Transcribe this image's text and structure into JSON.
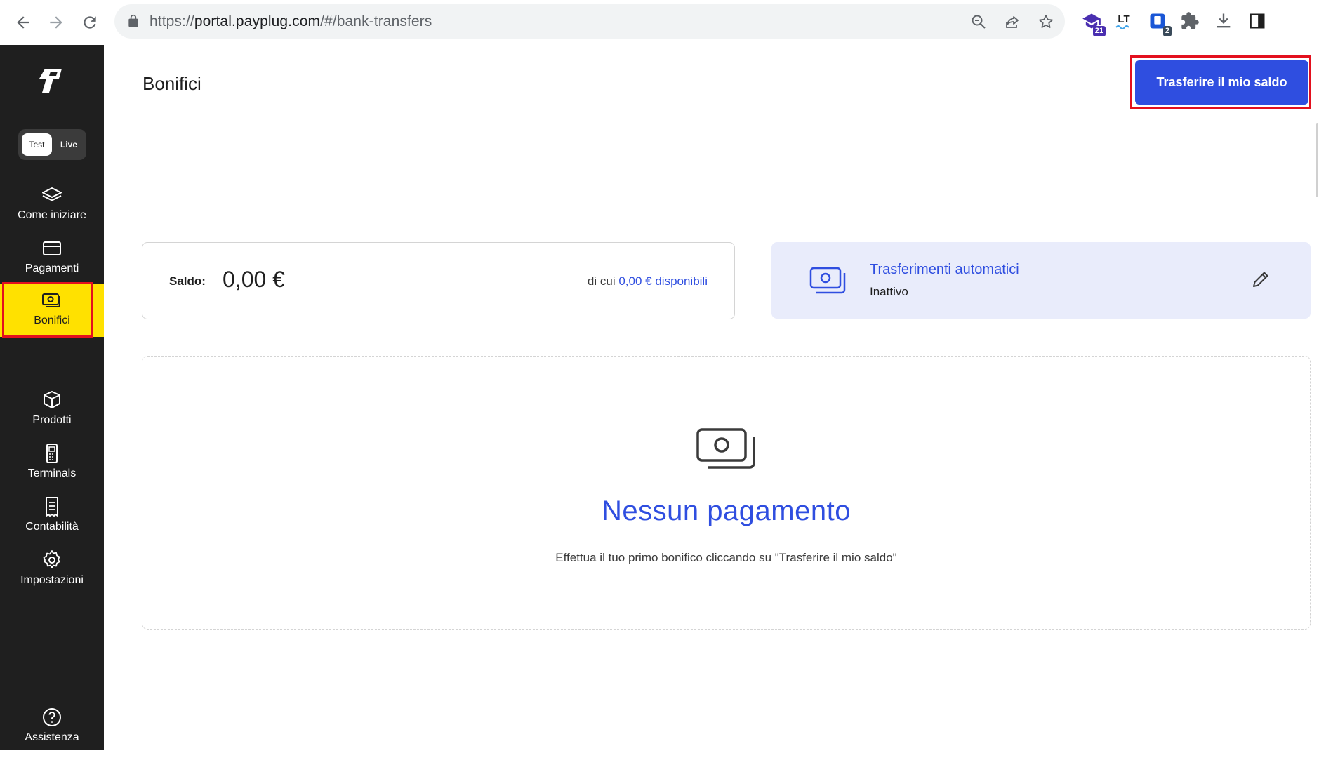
{
  "browser": {
    "url_prefix": "https://",
    "url_host": "portal.payplug.com",
    "url_path": "/#/bank-transfers",
    "extensions": {
      "graduation_badge": "21",
      "lt_label": "LT",
      "shield_badge": "2"
    }
  },
  "sidebar": {
    "mode_toggle": {
      "test": "Test",
      "live": "Live",
      "selected": "Test"
    },
    "items": [
      {
        "label": "Come iniziare",
        "icon": "layers-icon"
      },
      {
        "label": "Pagamenti",
        "icon": "card-icon"
      },
      {
        "label": "Bonifici",
        "icon": "money-icon",
        "active": true
      },
      {
        "label": "Prodotti",
        "icon": "box-icon"
      },
      {
        "label": "Terminals",
        "icon": "terminal-icon"
      },
      {
        "label": "Contabilità",
        "icon": "receipt-icon"
      },
      {
        "label": "Impostazioni",
        "icon": "gear-icon"
      }
    ],
    "help": {
      "label": "Assistenza",
      "icon": "help-icon"
    }
  },
  "header": {
    "title": "Bonifici",
    "cta_label": "Trasferire il mio saldo"
  },
  "balance": {
    "label": "Saldo:",
    "value": "0,00 €",
    "available_prefix": "di cui",
    "available_link": "0,00 € disponibili"
  },
  "auto_transfers": {
    "title": "Trasferimenti automatici",
    "status": "Inattivo"
  },
  "empty_state": {
    "title": "Nessun pagamento",
    "subtitle": "Effettua il tuo primo bonifico cliccando su \"Trasferire il mio saldo\""
  },
  "colors": {
    "accent": "#2f4ee0",
    "sidebar_bg": "#1f1f1f",
    "active_item": "#ffe100",
    "highlight": "#e3101e"
  }
}
